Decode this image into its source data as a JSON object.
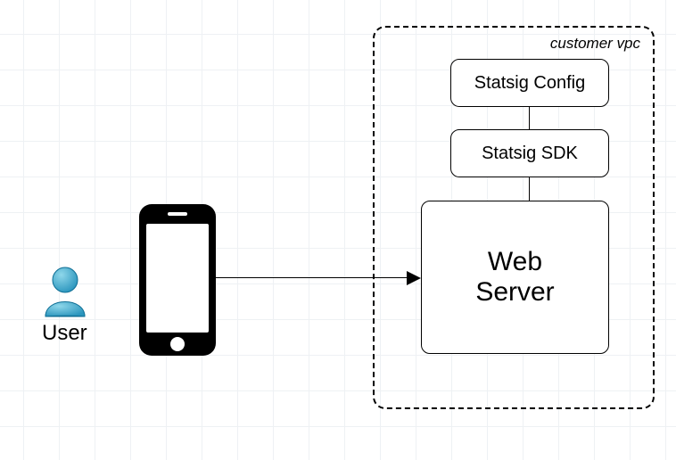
{
  "user": {
    "label": "User"
  },
  "vpc": {
    "title": "customer vpc"
  },
  "boxes": {
    "config": {
      "label": "Statsig Config"
    },
    "sdk": {
      "label": "Statsig SDK"
    },
    "web": {
      "line1": "Web",
      "line2": "Server"
    }
  },
  "colors": {
    "user_fill": "#3aa9cf",
    "user_stroke": "#0f6f95",
    "grid": "#eef1f4"
  }
}
